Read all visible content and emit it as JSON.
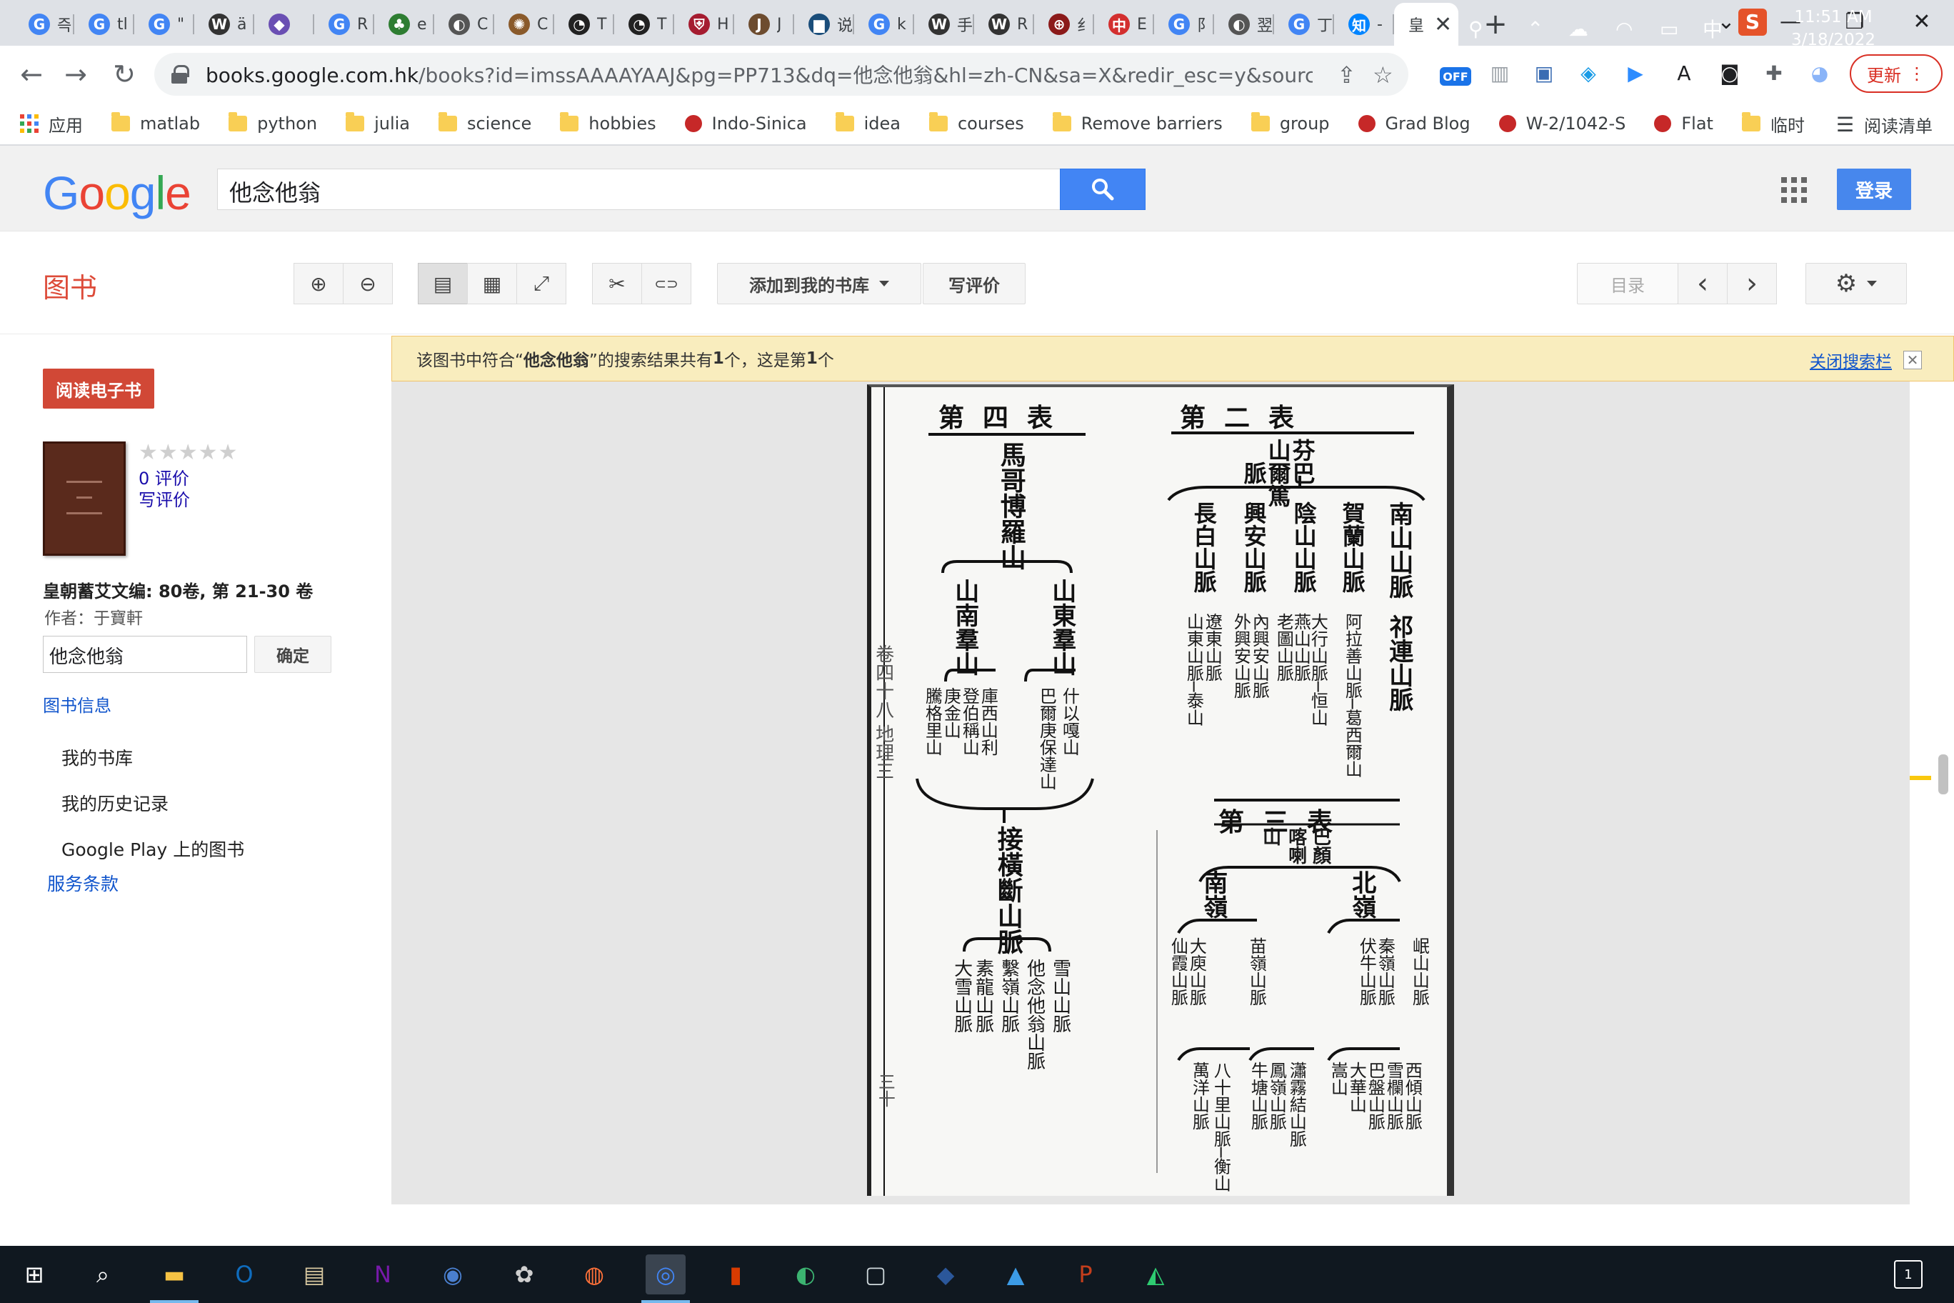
{
  "browser": {
    "tabs": [
      {
        "icon": "google-icon",
        "title": "즉",
        "color": "#4285f4",
        "glyph": "G"
      },
      {
        "icon": "google-icon",
        "title": "tl",
        "color": "#4285f4",
        "glyph": "G"
      },
      {
        "icon": "google-icon",
        "title": "\"",
        "color": "#4285f4",
        "glyph": "G"
      },
      {
        "icon": "wikipedia-icon",
        "title": "ä",
        "color": "#333333",
        "glyph": "W"
      },
      {
        "icon": "diamond-icon",
        "title": "",
        "color": "#6a4fb3",
        "glyph": "◆"
      },
      {
        "icon": "google-icon",
        "title": "R",
        "color": "#4285f4",
        "glyph": "G"
      },
      {
        "icon": "tree-icon",
        "title": "e",
        "color": "#2e7d32",
        "glyph": "♣"
      },
      {
        "icon": "globe-icon",
        "title": "C",
        "color": "#555555",
        "glyph": "◐"
      },
      {
        "icon": "sun-icon",
        "title": "C",
        "color": "#8a5a2b",
        "glyph": "✺"
      },
      {
        "icon": "clock-icon",
        "title": "T",
        "color": "#222222",
        "glyph": "◔"
      },
      {
        "icon": "clock-icon",
        "title": "T",
        "color": "#222222",
        "glyph": "◔"
      },
      {
        "icon": "shield-icon",
        "title": "H",
        "color": "#a51c30",
        "glyph": "⛨"
      },
      {
        "icon": "journal-icon",
        "title": "J",
        "color": "#6d4c2f",
        "glyph": "J"
      },
      {
        "icon": "book-icon",
        "title": "说",
        "color": "#1a4d7a",
        "glyph": "▆"
      },
      {
        "icon": "google-icon",
        "title": "k",
        "color": "#4285f4",
        "glyph": "G"
      },
      {
        "icon": "wikipedia-icon",
        "title": "手",
        "color": "#333333",
        "glyph": "W"
      },
      {
        "icon": "wikipedia-icon",
        "title": "R",
        "color": "#333333",
        "glyph": "W"
      },
      {
        "icon": "globe-icon",
        "title": "纟",
        "color": "#8b1a1a",
        "glyph": "⊕"
      },
      {
        "icon": "cn-site-icon",
        "title": "E",
        "color": "#d32f2f",
        "glyph": "中"
      },
      {
        "icon": "google-icon",
        "title": "阝",
        "color": "#4285f4",
        "glyph": "G"
      },
      {
        "icon": "globe-icon",
        "title": "翌",
        "color": "#555555",
        "glyph": "◐"
      },
      {
        "icon": "google-icon",
        "title": "丁",
        "color": "#4285f4",
        "glyph": "G"
      },
      {
        "icon": "zhihu-icon",
        "title": "-",
        "color": "#0084ff",
        "glyph": "知"
      }
    ],
    "active_tab": {
      "title": "皇",
      "close": "✕"
    },
    "new_tab": "+",
    "window_controls": {
      "tab_search": "⌄",
      "minimize": "—",
      "restore": "❐",
      "close": "✕"
    },
    "nav": {
      "back": "←",
      "forward": "→",
      "reload": "↻"
    },
    "url_host": "books.google.com.hk",
    "url_path": "/books?id=imssAAAAYAAJ&pg=PP713&dq=他念他翁&hl=zh-CN&sa=X&redir_esc=y&sourceid=cndr#v...",
    "share_icon": "⇪",
    "star_icon": "☆",
    "extensions": [
      {
        "name": "off-extension-icon",
        "glyph": "OFF",
        "color": "#1a73e8"
      },
      {
        "name": "reader-extension-icon",
        "glyph": "▥",
        "color": "#9aa0a6"
      },
      {
        "name": "notebook-extension-icon",
        "glyph": "▣",
        "color": "#3b6db3"
      },
      {
        "name": "diamond-extension-icon",
        "glyph": "◈",
        "color": "#1a9be6"
      },
      {
        "name": "zoom-extension-icon",
        "glyph": "▶",
        "color": "#2d8cff"
      },
      {
        "name": "font-extension-icon",
        "glyph": "A",
        "color": "#202124"
      },
      {
        "name": "mask-extension-icon",
        "glyph": "◙",
        "color": "#202124"
      },
      {
        "name": "puzzle-extension-icon",
        "glyph": "✚",
        "color": "#5f6368"
      },
      {
        "name": "avatar-extension-icon",
        "glyph": "◕",
        "color": "#8ab4f8"
      }
    ],
    "update_label": "更新",
    "update_menu": "⋮",
    "bookmarks": [
      {
        "label": "应用",
        "type": "apps"
      },
      {
        "label": "matlab",
        "type": "folder"
      },
      {
        "label": "python",
        "type": "folder"
      },
      {
        "label": "julia",
        "type": "folder"
      },
      {
        "label": "science",
        "type": "folder"
      },
      {
        "label": "hobbies",
        "type": "folder"
      },
      {
        "label": "Indo-Sinica",
        "type": "site"
      },
      {
        "label": "idea",
        "type": "folder"
      },
      {
        "label": "courses",
        "type": "folder"
      },
      {
        "label": "Remove barriers",
        "type": "folder"
      },
      {
        "label": "group",
        "type": "folder"
      },
      {
        "label": "Grad Blog",
        "type": "site"
      },
      {
        "label": "W-2/1042-S",
        "type": "site"
      },
      {
        "label": "Flat",
        "type": "site"
      },
      {
        "label": "临时",
        "type": "folder"
      }
    ],
    "reading_list": "阅读清单"
  },
  "google": {
    "logo": [
      "G",
      "o",
      "o",
      "g",
      "l",
      "e"
    ],
    "logo_colors": [
      "#4285f4",
      "#ea4335",
      "#fbbc05",
      "#4285f4",
      "#34a853",
      "#ea4335"
    ],
    "search_value": "他念他翁",
    "login": "登录"
  },
  "books": {
    "title": "图书",
    "add_library": "添加到我的书库",
    "write_review": "写评价",
    "toc": "目录",
    "prev": "‹",
    "next": "›",
    "settings": "⚙",
    "tools": {
      "zoom_in": "⊕",
      "zoom_out": "⊖",
      "single_page": "▤",
      "thumbnails": "▦",
      "fullscreen": "⤢",
      "clip": "✂",
      "link": "⊂⊃"
    }
  },
  "sidebar": {
    "read_ebook": "阅读电子书",
    "stars": "★★★★★",
    "rating_count": "0 评价",
    "write_review": "写评价",
    "book_title": "皇朝蓄艾文编: 80卷, 第 21-30 卷",
    "author": "作者：于寶軒",
    "search_value": "他念他翁",
    "search_ok": "确定",
    "book_info": "图书信息",
    "my_library": "我的书库",
    "history": "我的历史记录",
    "play_books": "Google Play 上的图书",
    "terms": "服务条款"
  },
  "notice": {
    "before": "该图书中符合“",
    "term": "他念他翁",
    "middle": "”的搜索结果共有 ",
    "count": "1",
    "middle2": " 个，这是第 ",
    "index": "1",
    "after": " 个",
    "close": "关闭搜索栏",
    "close_x": "✕"
  },
  "scan": {
    "table4_header": "第四表",
    "table2_header": "第二表",
    "table3_header": "第三表",
    "t4_root": "馬哥博羅山",
    "t4_branch_right": "山東羣山",
    "t4_branch_left": "山南羣山",
    "t4_right_sub1": "什以嘎山",
    "t4_right_sub2": "巴爾庚保達山",
    "t4_left_sub1": "庫西山利",
    "t4_left_sub2": "登伯稱山",
    "t4_left_sub3": "庚金山",
    "t4_left_sub4": "騰格里山",
    "t4_join": "接橫斷山脈",
    "t4_bottom1": "雪山山脈",
    "t4_bottom2": "他念他翁山脈",
    "t4_bottom3": "繫嶺山脈",
    "t4_bottom4": "素龍山脈",
    "t4_bottom5": "大雪山脈",
    "t2_root_a": "芬巴",
    "t2_root_b": "山爾篤",
    "t2_root_c": "脈",
    "t2_col1": "南山山脈",
    "t2_col1_sub": "祁連山脈",
    "t2_col2": "賀蘭山脈",
    "t2_col2_sub": "阿拉善山脈─葛西爾山",
    "t2_col3": "陰山山脈",
    "t2_col3_sub1": "大行山脈─恒山",
    "t2_col3_sub2": "燕山山脈",
    "t2_col3_sub3": "老圖山脈",
    "t2_col4": "興安山脈",
    "t2_col4_sub1": "內興安山脈",
    "t2_col4_sub2": "外興安山脈",
    "t2_col5": "長白山脈",
    "t2_col5_sub1": "遼東山脈",
    "t2_col5_sub2": "山東山脈─泰山",
    "t3_root_a": "巴顏",
    "t3_root_b": "喀喇",
    "t3_root_c": "山",
    "t3_north": "北嶺",
    "t3_south": "南嶺",
    "t3_n1": "岷山山脈",
    "t3_n2": "秦嶺山脈",
    "t3_n2b": "伏牛山脈",
    "t3_n_sub1": "西傾山脈",
    "t3_n_sub2": "雪欄山脈",
    "t3_n_sub3": "巴盤山脈",
    "t3_n_sub4": "大華山",
    "t3_n_sub5": "嵩山",
    "t3_s1": "苗嶺山脈",
    "t3_s2": "大庾山脈",
    "t3_s2b": "仙霞山脈",
    "t3_s_sub1": "瀟霧結山脈",
    "t3_s_sub2": "鳳嶺山脈",
    "t3_s_sub3": "牛塘山脈",
    "t3_s_sub4": "八十里山脈─衡山",
    "t3_s_sub5": "萬洋山脈",
    "edge_marks": "卷四十八  地理三",
    "page_num": "三十"
  },
  "taskbar": {
    "apps": [
      {
        "name": "start-icon",
        "glyph": "⊞"
      },
      {
        "name": "search-icon",
        "glyph": "⌕"
      },
      {
        "name": "file-explorer-icon",
        "glyph": "▬"
      },
      {
        "name": "outlook-icon",
        "glyph": "O"
      },
      {
        "name": "reader-icon",
        "glyph": "▤"
      },
      {
        "name": "onenote-icon",
        "glyph": "N"
      },
      {
        "name": "app-icon",
        "glyph": "◉"
      },
      {
        "name": "app-icon",
        "glyph": "✿"
      },
      {
        "name": "firefox-icon",
        "glyph": "◍"
      },
      {
        "name": "chrome-icon",
        "glyph": "◎"
      },
      {
        "name": "office-icon",
        "glyph": "▮"
      },
      {
        "name": "app-icon",
        "glyph": "◐"
      },
      {
        "name": "app-icon",
        "glyph": "▢"
      },
      {
        "name": "app-icon",
        "glyph": "◆"
      },
      {
        "name": "photos-icon",
        "glyph": "▲"
      },
      {
        "name": "powerpoint-icon",
        "glyph": "P"
      },
      {
        "name": "app-icon",
        "glyph": "◭"
      }
    ],
    "tray": {
      "person": "⚲",
      "chevron": "⌃",
      "cloud": "☁",
      "wifi": "◠",
      "battery": "▭",
      "ime": "中",
      "sogou": "S"
    },
    "time": "11:51 AM",
    "date": "3/18/2022",
    "notifications": "1"
  }
}
